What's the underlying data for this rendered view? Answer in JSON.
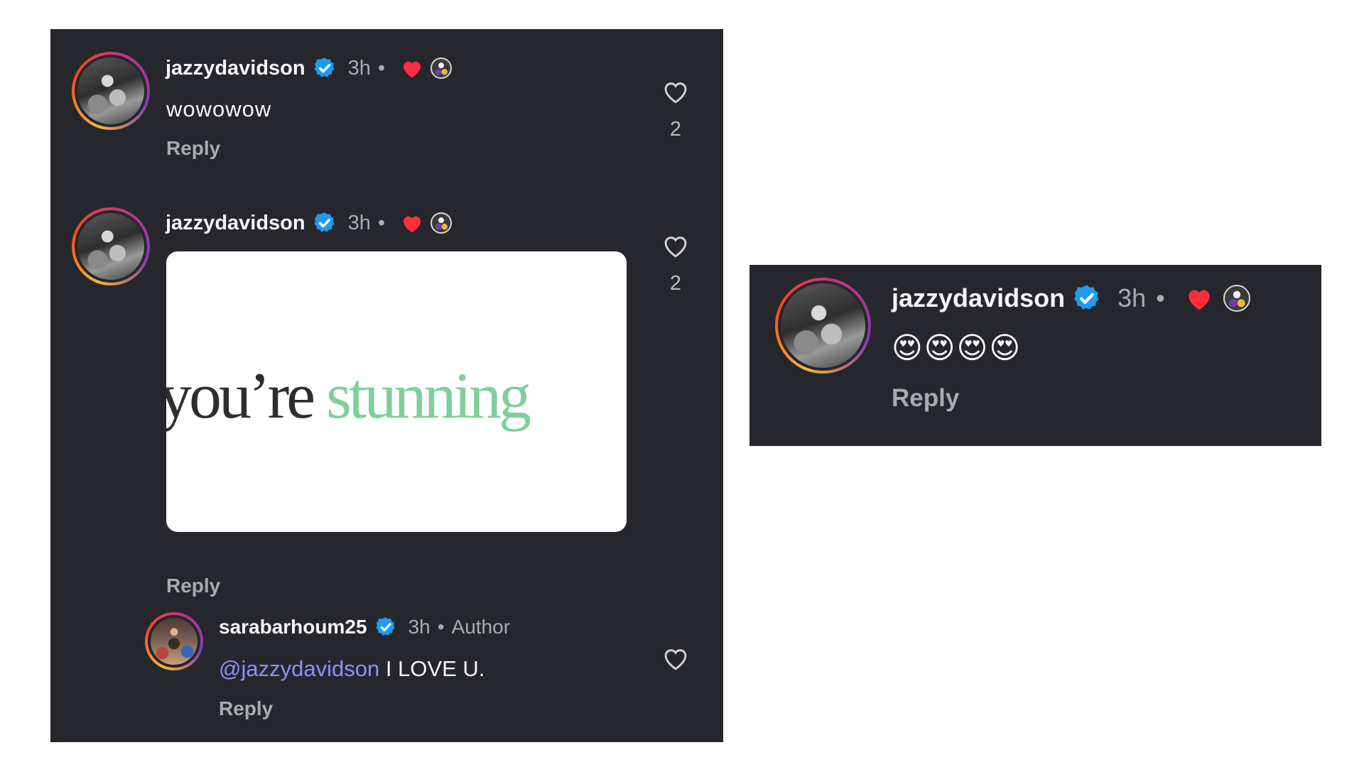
{
  "comments": [
    {
      "username": "jazzydavidson",
      "time": "3h",
      "separator": "•",
      "text": "wowowow",
      "reply_label": "Reply",
      "likes": "2"
    },
    {
      "username": "jazzydavidson",
      "time": "3h",
      "separator": "•",
      "gif_text_dark": "you’re",
      "gif_text_green": "stunning",
      "reply_label": "Reply",
      "likes": "2"
    },
    {
      "username": "sarabarhoum25",
      "time": "3h",
      "separator": "•",
      "author_badge": "Author",
      "mention": "@jazzydavidson",
      "text": "I LOVE U.",
      "reply_label": "Reply"
    }
  ],
  "right_comment": {
    "username": "jazzydavidson",
    "time": "3h",
    "separator": "•",
    "text": "😍😍😍😍",
    "reply_label": "Reply"
  },
  "colors": {
    "panel_bg": "#25272c",
    "verified": "#1d9bf0",
    "liked_heart": "#ff2d3d",
    "mention": "#8e90ff",
    "gif_green": "#7fcf9b"
  },
  "icons": {
    "verified": "verified-badge-icon",
    "liked_by_author": "heart-filled-icon",
    "like": "heart-outline-icon"
  }
}
